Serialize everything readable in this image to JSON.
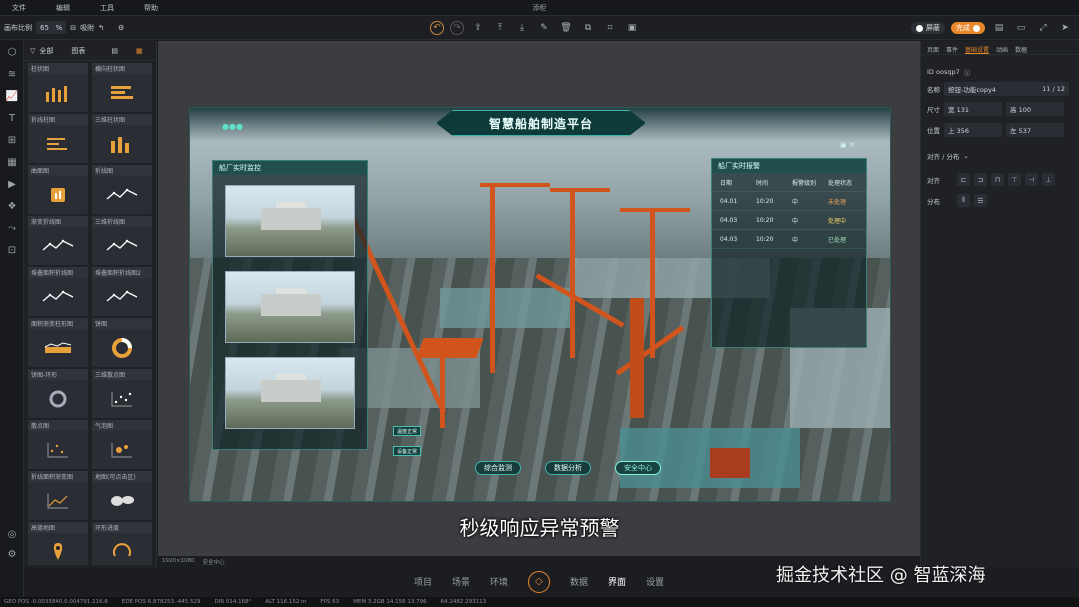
{
  "menu": {
    "items": [
      "文件",
      "编辑",
      "工具",
      "帮助"
    ],
    "title": "添柜"
  },
  "toolbar": {
    "scale_label": "画布比例",
    "scale_value": "65",
    "scale_unit": "%",
    "snap_label": "吸附",
    "switch_a": "屏蔽",
    "switch_b": "完成"
  },
  "components": {
    "tab_all": "全部",
    "tab_chart": "图表",
    "items": [
      {
        "label": "柱状图",
        "icon": "bar-chart-icon"
      },
      {
        "label": "横向柱状图",
        "icon": "hbar-chart-icon"
      },
      {
        "label": "折线柱图",
        "icon": "hbar-line-icon"
      },
      {
        "label": "三维柱状图",
        "icon": "3d-bar-icon"
      },
      {
        "label": "曲面图",
        "icon": "surface-chart-icon"
      },
      {
        "label": "折线图",
        "icon": "line-chart-icon"
      },
      {
        "label": "渐变折线图",
        "icon": "gradient-line-icon"
      },
      {
        "label": "三维折线图",
        "icon": "3d-line-icon"
      },
      {
        "label": "堆叠面积折线图",
        "icon": "stack-area-icon"
      },
      {
        "label": "堆叠面积折线图2",
        "icon": "stack-area-2-icon"
      },
      {
        "label": "面积渐变柱形图",
        "icon": "area-bar-icon"
      },
      {
        "label": "饼图",
        "icon": "pie-chart-icon"
      },
      {
        "label": "饼图-环形",
        "icon": "ring-chart-icon"
      },
      {
        "label": "三维散点图",
        "icon": "3d-scatter-icon"
      },
      {
        "label": "散点图",
        "icon": "scatter-icon"
      },
      {
        "label": "气泡图",
        "icon": "bubble-icon"
      },
      {
        "label": "折线面积渐变图",
        "icon": "line-area-icon"
      },
      {
        "label": "地图(可点击区)",
        "icon": "world-map-icon"
      },
      {
        "label": "高德地图",
        "icon": "map-pin-icon"
      },
      {
        "label": "环形进度",
        "icon": "gauge-icon"
      }
    ]
  },
  "screen": {
    "title": "智慧船舶制造平台",
    "left_panel_title": "船厂实时监控",
    "right_panel_title": "船厂实时报警",
    "table_headers": [
      "日期",
      "时间",
      "报警级别",
      "处理状态"
    ],
    "table_rows": [
      [
        "04.01",
        "10:20",
        "中",
        "未处理"
      ],
      [
        "04.03",
        "10:20",
        "中",
        "处理中"
      ],
      [
        "04.03",
        "10:20",
        "中",
        "已处理"
      ]
    ],
    "mini_a": "温度正常",
    "mini_b": "设备正常",
    "buttons": [
      "综合监测",
      "数据分析",
      "安全中心"
    ]
  },
  "caption": "秒级响应异常预警",
  "props": {
    "tabs": [
      "页面",
      "事件",
      "基础设置",
      "动画",
      "数据"
    ],
    "id_value": "ID oosqp7",
    "name_label": "名称",
    "name_value": "按钮-功能copy4",
    "name_count": "11 / 12",
    "size_label": "尺寸",
    "width": "宽 131",
    "height": "高 100",
    "pos_label": "位置",
    "top": "上 356",
    "left": "左 537",
    "align_section": "对齐 / 分布",
    "align_label": "对齐",
    "dist_label": "分布"
  },
  "bottom_nav": {
    "items": [
      "项目",
      "场景",
      "环境",
      "数据",
      "界面",
      "设置"
    ],
    "active": "界面"
  },
  "canvas_info": {
    "size": "1920×1080",
    "scene": "安全中心"
  },
  "status": {
    "items": [
      "GEO POS  -0.0035840.0.004791.116.6",
      "EDE POS  6.878253.-445.529",
      "DIR  014.168°",
      "ALT  116.152 m",
      "FPS  63",
      "MEM  3.2GB  14.156  13.796",
      "64.2482.293113"
    ]
  },
  "watermark": "掘金技术社区 @ 智蓝深海",
  "colors": {
    "accent": "#e8872a",
    "hud": "#3fb3a7"
  }
}
